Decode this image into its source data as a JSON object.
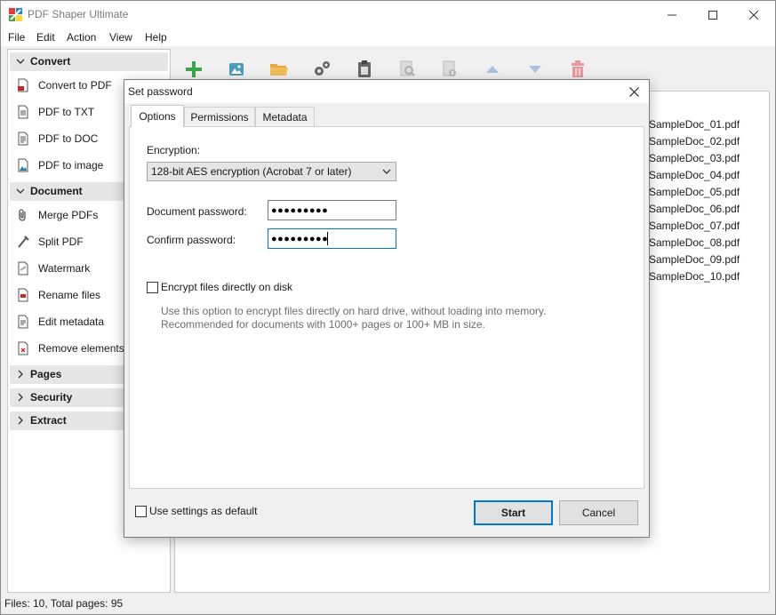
{
  "app": {
    "title": "PDF Shaper Ultimate",
    "logo_icon": "pdf-shaper-logo",
    "status": "Files: 10, Total pages: 95"
  },
  "menu": [
    "File",
    "Edit",
    "Action",
    "View",
    "Help"
  ],
  "sidebar": {
    "sections": [
      {
        "label": "Convert",
        "expanded": true,
        "items": [
          {
            "label": "Convert to PDF",
            "icon": "convert-to-pdf-icon"
          },
          {
            "label": "PDF to TXT",
            "icon": "pdf-to-txt-icon"
          },
          {
            "label": "PDF to DOC",
            "icon": "pdf-to-doc-icon"
          },
          {
            "label": "PDF to image",
            "icon": "pdf-to-image-icon"
          }
        ]
      },
      {
        "label": "Document",
        "expanded": true,
        "items": [
          {
            "label": "Merge PDFs",
            "icon": "paperclip-icon"
          },
          {
            "label": "Split PDF",
            "icon": "split-icon"
          },
          {
            "label": "Watermark",
            "icon": "watermark-icon"
          },
          {
            "label": "Rename files",
            "icon": "rename-icon"
          },
          {
            "label": "Edit metadata",
            "icon": "metadata-icon"
          },
          {
            "label": "Remove elements",
            "icon": "remove-elements-icon"
          }
        ]
      },
      {
        "label": "Pages",
        "expanded": false,
        "items": []
      },
      {
        "label": "Security",
        "expanded": false,
        "items": []
      },
      {
        "label": "Extract",
        "expanded": false,
        "items": []
      }
    ]
  },
  "toolbar": [
    {
      "icon": "add-icon",
      "enabled": true
    },
    {
      "icon": "add-image-icon",
      "enabled": true
    },
    {
      "icon": "open-folder-icon",
      "enabled": true
    },
    {
      "icon": "settings-gears-icon",
      "enabled": true
    },
    {
      "icon": "clipboard-icon",
      "enabled": true
    },
    {
      "icon": "search-document-icon",
      "enabled": false
    },
    {
      "icon": "document-info-icon",
      "enabled": false
    },
    {
      "icon": "move-up-icon",
      "enabled": false
    },
    {
      "icon": "move-down-icon",
      "enabled": false
    },
    {
      "icon": "delete-icon",
      "enabled": false
    }
  ],
  "files": [
    "SampleDoc_01.pdf",
    "SampleDoc_02.pdf",
    "SampleDoc_03.pdf",
    "SampleDoc_04.pdf",
    "SampleDoc_05.pdf",
    "SampleDoc_06.pdf",
    "SampleDoc_07.pdf",
    "SampleDoc_08.pdf",
    "SampleDoc_09.pdf",
    "SampleDoc_10.pdf"
  ],
  "dialog": {
    "title": "Set password",
    "tabs": [
      "Options",
      "Permissions",
      "Metadata"
    ],
    "active_tab": "Options",
    "encryption_label": "Encryption:",
    "encryption_value": "128-bit AES encryption (Acrobat 7 or later)",
    "document_password_label": "Document password:",
    "document_password_value": "●●●●●●●●●",
    "confirm_password_label": "Confirm password:",
    "confirm_password_value": "●●●●●●●●●",
    "encrypt_on_disk_label": "Encrypt files directly on disk",
    "encrypt_on_disk_checked": false,
    "hint_line1": "Use this option to encrypt files directly on hard drive, without loading into memory.",
    "hint_line2": "Recommended for documents with 1000+ pages or 100+ MB in size.",
    "use_default_label": "Use settings as default",
    "use_default_checked": false,
    "start_label": "Start",
    "cancel_label": "Cancel"
  },
  "colors": {
    "accent": "#0078d7",
    "window_bg": "#f0f0f0",
    "section_header_bg": "#e6e6e6",
    "hint_text": "#6d6d6d"
  }
}
